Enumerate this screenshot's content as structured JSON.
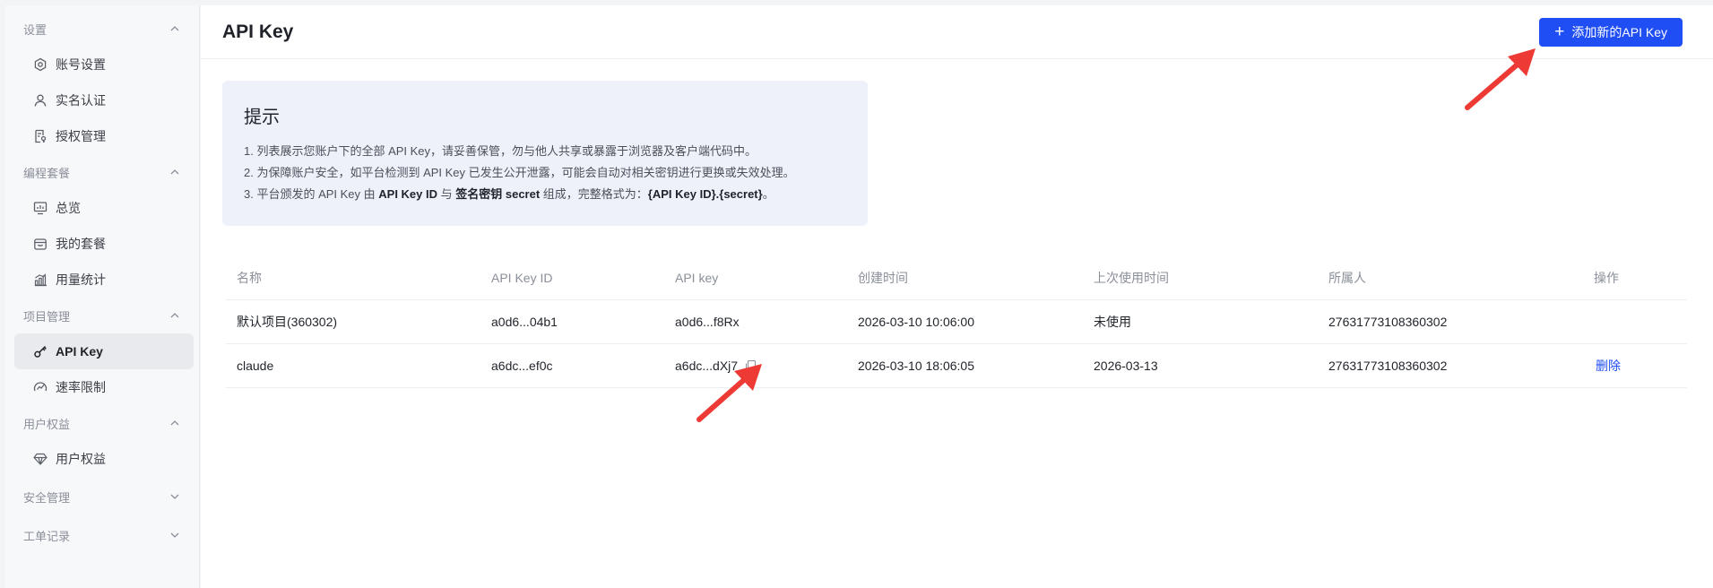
{
  "sidebar": {
    "groups": [
      {
        "title": "设置",
        "expanded": true,
        "items": [
          {
            "label": "账号设置",
            "icon": "settings-hex-icon"
          },
          {
            "label": "实名认证",
            "icon": "user-icon"
          },
          {
            "label": "授权管理",
            "icon": "document-key-icon"
          }
        ]
      },
      {
        "title": "编程套餐",
        "expanded": true,
        "items": [
          {
            "label": "总览",
            "icon": "dashboard-icon"
          },
          {
            "label": "我的套餐",
            "icon": "package-icon"
          },
          {
            "label": "用量统计",
            "icon": "bar-chart-icon"
          }
        ]
      },
      {
        "title": "项目管理",
        "expanded": true,
        "items": [
          {
            "label": "API Key",
            "icon": "key-icon",
            "active": true
          },
          {
            "label": "速率限制",
            "icon": "speedometer-icon"
          }
        ]
      },
      {
        "title": "用户权益",
        "expanded": true,
        "items": [
          {
            "label": "用户权益",
            "icon": "diamond-icon"
          }
        ]
      },
      {
        "title": "安全管理",
        "expanded": false,
        "items": []
      },
      {
        "title": "工单记录",
        "expanded": false,
        "items": []
      }
    ]
  },
  "header": {
    "title": "API Key",
    "add_button_label": "添加新的API Key"
  },
  "tip": {
    "title": "提示",
    "line1": "1. 列表展示您账户下的全部 API Key，请妥善保管，勿与他人共享或暴露于浏览器及客户端代码中。",
    "line2": "2. 为保障账户安全，如平台检测到 API Key 已发生公开泄露，可能会自动对相关密钥进行更换或失效处理。",
    "line3_pre": "3. 平台颁发的 API Key 由 ",
    "line3_b1": "API Key ID",
    "line3_mid1": " 与 ",
    "line3_b2": "签名密钥 secret",
    "line3_mid2": " 组成，完整格式为：",
    "line3_b3": "{API Key ID}.{secret}",
    "line3_end": "。"
  },
  "table": {
    "columns": [
      "名称",
      "API Key ID",
      "API key",
      "创建时间",
      "上次使用时间",
      "所属人",
      "操作"
    ],
    "rows": [
      {
        "name": "默认项目(360302)",
        "key_id": "a0d6...04b1",
        "api_key": "a0d6...f8Rx",
        "created": "2026-03-10 10:06:00",
        "last_used": "未使用",
        "owner": "27631773108360302",
        "action": "",
        "copy": false
      },
      {
        "name": "claude",
        "key_id": "a6dc...ef0c",
        "api_key": "a6dc...dXj7",
        "created": "2026-03-10 18:06:05",
        "last_used": "2026-03-13",
        "owner": "27631773108360302",
        "action": "删除",
        "copy": true
      }
    ]
  },
  "colors": {
    "primary": "#1f4ef5",
    "annotation_arrow": "#ee3a34",
    "tip_bg": "#eef1fa"
  }
}
